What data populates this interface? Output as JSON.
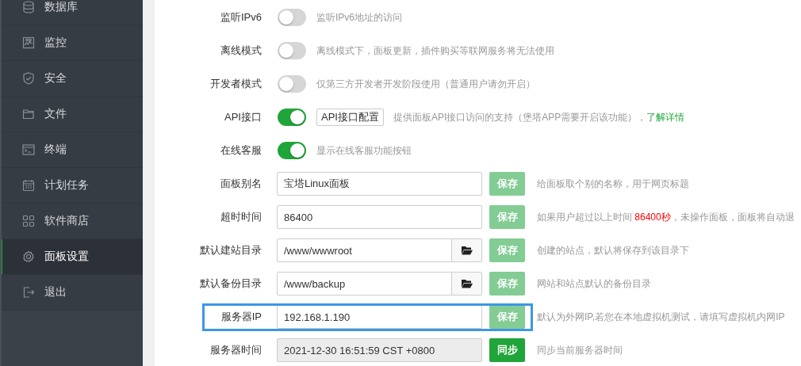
{
  "sidebar": {
    "items": [
      {
        "label": "数据库",
        "selected": false
      },
      {
        "label": "监控",
        "selected": false
      },
      {
        "label": "安全",
        "selected": false
      },
      {
        "label": "文件",
        "selected": false
      },
      {
        "label": "终端",
        "selected": false
      },
      {
        "label": "计划任务",
        "selected": false
      },
      {
        "label": "软件商店",
        "selected": false
      },
      {
        "label": "面板设置",
        "selected": true
      },
      {
        "label": "退出",
        "selected": false
      }
    ]
  },
  "settings": {
    "toggles": [
      {
        "label": "监听IPv6",
        "on": false,
        "description": "监听IPv6地址的访问"
      },
      {
        "label": "离线模式",
        "on": false,
        "description": "离线模式下，面板更新，插件购买等联网服务将无法使用"
      },
      {
        "label": "开发者模式",
        "on": false,
        "description": "仅第三方开发者开发阶段使用（普通用户请勿开启）"
      },
      {
        "label": "API接口",
        "on": true,
        "button": "API接口配置",
        "description": "提供面板API接口访问的支持（堡塔APP需要开启该功能），",
        "link": "了解详情"
      },
      {
        "label": "在线客服",
        "on": true,
        "description": "显示在线客服功能按钮"
      }
    ],
    "fields": [
      {
        "label": "面板别名",
        "value": "宝塔Linux面板",
        "kind": "text",
        "readonly": false,
        "highlighted": false,
        "button": {
          "label": "保存",
          "disabled": true
        },
        "hint": [
          {
            "text": "给面板取个别的名称，用于网页标题",
            "emphasis": false
          }
        ]
      },
      {
        "label": "超时时间",
        "value": "86400",
        "kind": "text",
        "readonly": false,
        "highlighted": false,
        "button": {
          "label": "保存",
          "disabled": true
        },
        "hint": [
          {
            "text": "如果用户超过以上时间 ",
            "emphasis": false
          },
          {
            "text": "86400秒",
            "emphasis": true
          },
          {
            "text": "，未操作面板，面板将自动退",
            "emphasis": false
          }
        ]
      },
      {
        "label": "默认建站目录",
        "value": "/www/wwwroot",
        "kind": "path",
        "readonly": false,
        "highlighted": false,
        "button": {
          "label": "保存",
          "disabled": true
        },
        "hint": [
          {
            "text": "创建的站点，默认将保存到该目录下",
            "emphasis": false
          }
        ]
      },
      {
        "label": "默认备份目录",
        "value": "/www/backup",
        "kind": "path",
        "readonly": false,
        "highlighted": false,
        "button": {
          "label": "保存",
          "disabled": true
        },
        "hint": [
          {
            "text": "网站和站点默认的备份目录",
            "emphasis": false
          }
        ]
      },
      {
        "label": "服务器IP",
        "value": "192.168.1.190",
        "kind": "text",
        "readonly": false,
        "highlighted": true,
        "button": {
          "label": "保存",
          "disabled": true
        },
        "hint": [
          {
            "text": "默认为外网IP,若您在本地虚拟机测试，请填写虚拟机内网IP",
            "emphasis": false
          }
        ]
      },
      {
        "label": "服务器时间",
        "value": "2021-12-30 16:51:59 CST +0800",
        "kind": "text",
        "readonly": true,
        "highlighted": false,
        "button": {
          "label": "同步",
          "disabled": false
        },
        "hint": [
          {
            "text": "同步当前服务器时间",
            "emphasis": false
          }
        ]
      }
    ]
  }
}
